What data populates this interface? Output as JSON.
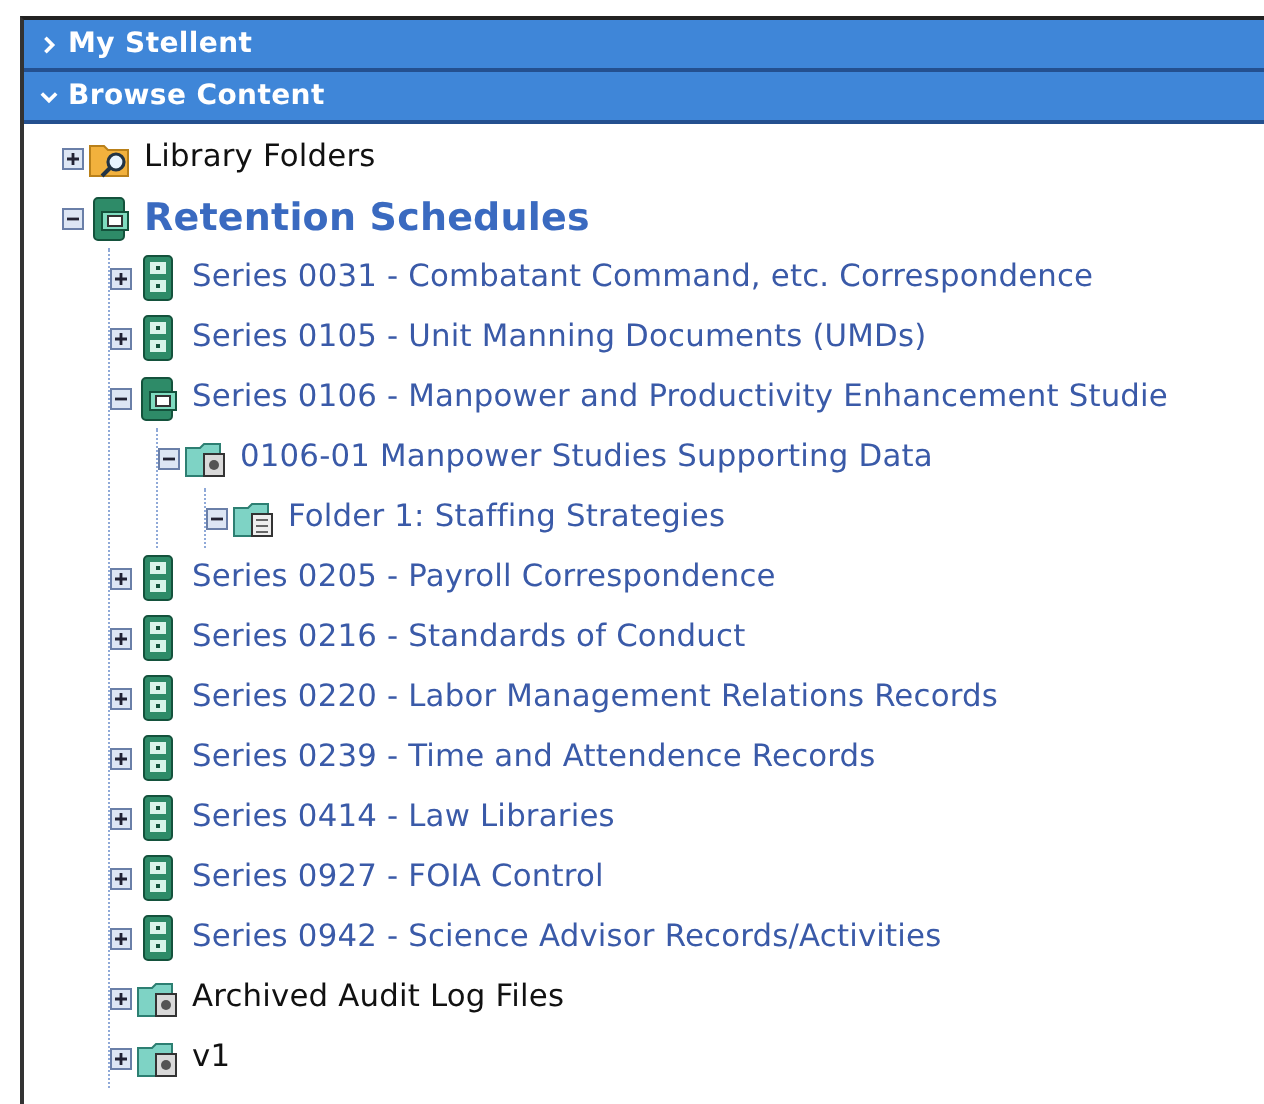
{
  "sections": [
    {
      "title": "My Stellent",
      "expanded": false
    },
    {
      "title": "Browse Content",
      "expanded": true
    }
  ],
  "tree": [
    {
      "label": "Library Folders",
      "kind": "library",
      "expanded": false,
      "selected": false
    },
    {
      "label": "Retention Schedules",
      "kind": "retention",
      "expanded": true,
      "selected": true,
      "children": [
        {
          "label": "Series 0031 - Combatant Command, etc. Correspondence",
          "kind": "series",
          "expanded": false,
          "selected": false
        },
        {
          "label": "Series 0105 - Unit Manning Documents (UMDs)",
          "kind": "series",
          "expanded": false,
          "selected": false
        },
        {
          "label": "Series 0106 - Manpower and Productivity Enhancement Studie",
          "kind": "series",
          "expanded": true,
          "selected": false,
          "children": [
            {
              "label": "0106-01 Manpower Studies Supporting Data",
              "kind": "category",
              "expanded": true,
              "selected": false,
              "children": [
                {
                  "label": "Folder 1: Staffing Strategies",
                  "kind": "folder",
                  "expanded": true,
                  "selected": false
                }
              ]
            }
          ]
        },
        {
          "label": "Series 0205 - Payroll Correspondence",
          "kind": "series",
          "expanded": false,
          "selected": false
        },
        {
          "label": "Series 0216 - Standards of Conduct",
          "kind": "series",
          "expanded": false,
          "selected": false
        },
        {
          "label": "Series 0220 - Labor Management Relations Records",
          "kind": "series",
          "expanded": false,
          "selected": false
        },
        {
          "label": "Series 0239 - Time and Attendence Records",
          "kind": "series",
          "expanded": false,
          "selected": false
        },
        {
          "label": "Series 0414 - Law Libraries",
          "kind": "series",
          "expanded": false,
          "selected": false
        },
        {
          "label": "Series 0927 - FOIA Control",
          "kind": "series",
          "expanded": false,
          "selected": false
        },
        {
          "label": "Series 0942 - Science Advisor Records/Activities",
          "kind": "series",
          "expanded": false,
          "selected": false
        },
        {
          "label": "Archived Audit Log Files",
          "kind": "archive",
          "expanded": false,
          "selected": false
        },
        {
          "label": "v1",
          "kind": "archive",
          "expanded": false,
          "selected": false
        }
      ]
    }
  ]
}
